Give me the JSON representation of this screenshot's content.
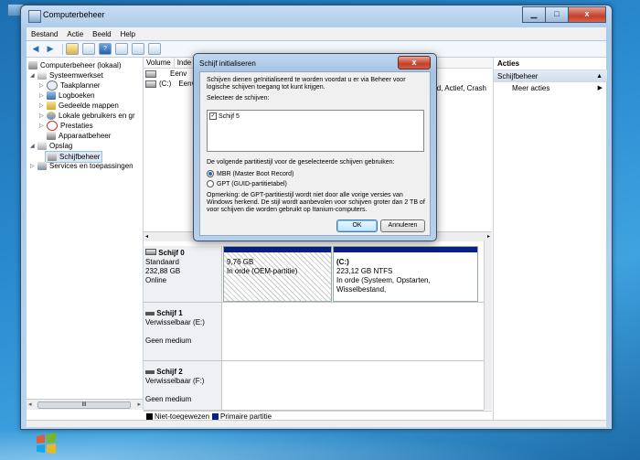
{
  "desktop": {
    "icon": "computer-icon"
  },
  "window": {
    "title": "Computerbeheer",
    "controls": {
      "minimize": "▁",
      "maximize": "□",
      "close": "x"
    }
  },
  "menu": [
    "Bestand",
    "Actie",
    "Beeld",
    "Help"
  ],
  "tree": {
    "root": "Computerbeheer (lokaal)",
    "systeemwerkset": "Systeemwerkset",
    "taakplanner": "Taakplanner",
    "logboeken": "Logboeken",
    "gedeelde": "Gedeelde mappen",
    "lokale": "Lokale gebruikers en gr",
    "prestaties": "Prestaties",
    "apparaat": "Apparaatbeheer",
    "opslag": "Opslag",
    "schijfbeheer": "Schijfbeheer",
    "services": "Services en toepassingen",
    "scroll_mid": "III"
  },
  "volumes": {
    "col_volume": "Volume",
    "col_indeling": "Inde",
    "row1": "Eenv",
    "row2_name": "(C:)",
    "row2_type": "Eenv",
    "right_text": "and, Actief, Crash"
  },
  "disks": [
    {
      "name": "Schijf 0",
      "type": "Standaard",
      "size": "232,88 GB",
      "state": "Online"
    },
    {
      "name": "Schijf 1",
      "type": "Verwisselbaar (E:)",
      "state": "Geen medium"
    },
    {
      "name": "Schijf 2",
      "type": "Verwisselbaar (F:)",
      "state": "Geen medium"
    }
  ],
  "partitions": {
    "oem_size": "9,76 GB",
    "oem_state": "In orde (OEM-partitie)",
    "c_name": "(C:)",
    "c_size": "223,12 GB NTFS",
    "c_state": "In orde (Systeem, Opstarten, Wisselbestand,"
  },
  "legend": {
    "unallocated": "Niet-toegewezen",
    "primary": "Primaire partitie"
  },
  "actions": {
    "title": "Acties",
    "section": "Schijfbeheer",
    "more": "Meer acties"
  },
  "dialog": {
    "title": "Schijf initialiseren",
    "intro": "Schijven dienen geïnitialiseerd te worden voordat u er via Beheer voor logische schijven toegang tot kunt krijgen.",
    "select_label": "Selecteer de schijven:",
    "disk_item": "Schijf 5",
    "style_label": "De volgende partitiestijl voor de geselecteerde schijven gebruiken:",
    "mbr": "MBR (Master Boot Record)",
    "gpt": "GPT (GUID-partitietabel)",
    "note": "Opmerking: de GPT-partitiestijl wordt niet door alle vorige versies van Windows herkend. De stijl wordt aanbevolen voor schijven groter dan 2 TB of voor schijven die worden gebruikt op Itanium-computers.",
    "ok": "OK",
    "cancel": "Annuleren",
    "close": "x"
  },
  "colors": {
    "primary_partition": "#0a2184",
    "unallocated": "#000000",
    "accent": "#3c7fb1"
  }
}
